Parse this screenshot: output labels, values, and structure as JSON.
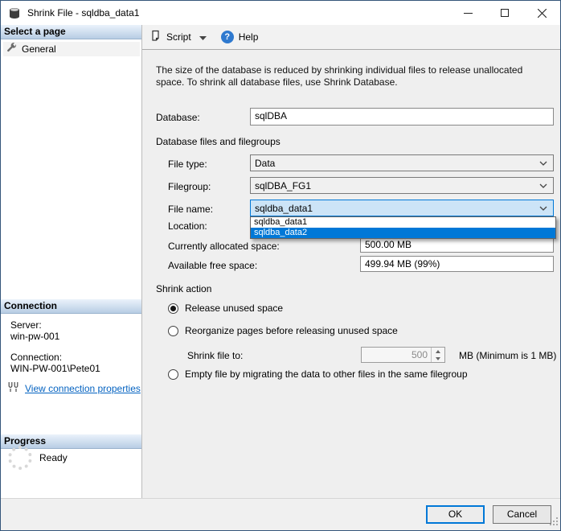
{
  "window": {
    "title": "Shrink File - sqldba_data1"
  },
  "toolbar": {
    "script_label": "Script",
    "help_label": "Help",
    "help_icon_glyph": "?"
  },
  "sidebar": {
    "select_page_header": "Select a page",
    "general_item": "General",
    "connection_header": "Connection",
    "server_label": "Server:",
    "server_value": "win-pw-001",
    "connection_label": "Connection:",
    "connection_value": "WIN-PW-001\\Pete01",
    "view_connection_link": "View connection properties",
    "progress_header": "Progress",
    "progress_status": "Ready"
  },
  "main": {
    "description": "The size of the database is reduced by shrinking individual files to release unallocated space. To shrink all database files, use Shrink Database.",
    "database_label": "Database:",
    "database_value": "sqlDBA",
    "files_section_label": "Database files and filegroups",
    "file_type_label": "File type:",
    "file_type_value": "Data",
    "filegroup_label": "Filegroup:",
    "filegroup_value": "sqlDBA_FG1",
    "file_name_label": "File name:",
    "file_name_value": "sqldba_data1",
    "file_name_options": [
      "sqldba_data1",
      "sqldba_data2"
    ],
    "location_label": "Location:",
    "allocated_label": "Currently allocated space:",
    "allocated_value": "500.00 MB",
    "free_label": "Available free space:",
    "free_value": "499.94 MB (99%)",
    "shrink_action_label": "Shrink action",
    "radio_release_label": "Release unused space",
    "radio_reorganize_label": "Reorganize pages before releasing unused space",
    "shrink_file_to_label": "Shrink file to:",
    "shrink_file_to_value": "500",
    "shrink_file_to_suffix": "MB (Minimum is 1 MB)",
    "radio_empty_label": "Empty file by migrating the data to other files in the same filegroup"
  },
  "footer": {
    "ok_label": "OK",
    "cancel_label": "Cancel"
  },
  "colors": {
    "accent": "#0078d7",
    "focus_fill": "#cce4f7",
    "selection": "#0078d7",
    "header_gradient_top": "#eaf2fb",
    "header_gradient_bottom": "#b7cde4",
    "link": "#0563c1"
  }
}
